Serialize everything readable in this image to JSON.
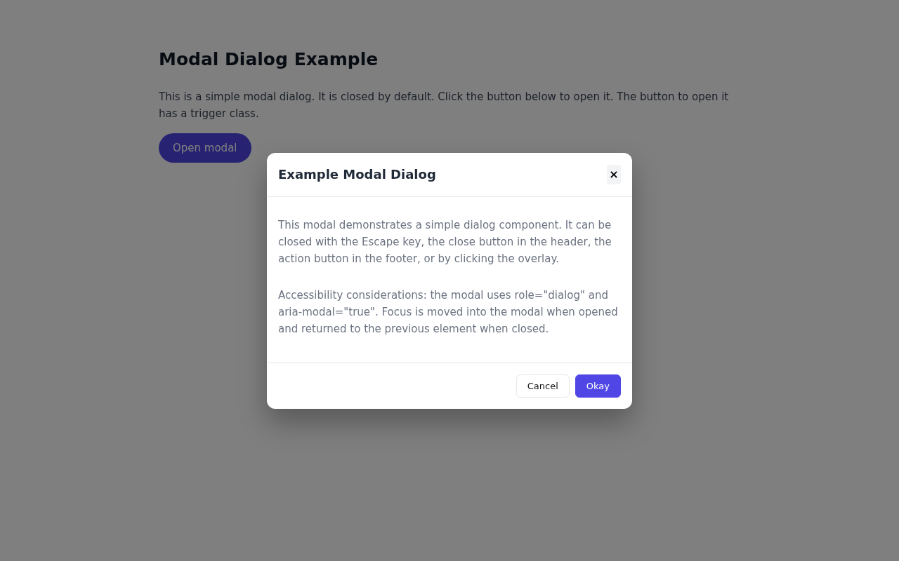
{
  "page": {
    "title": "Modal Dialog Example",
    "description": "This is a simple modal dialog. It is closed by default. Click the button below to open it. The button to open it has a trigger class.",
    "open_button": "Open modal"
  },
  "modal": {
    "title": "Example Modal Dialog",
    "close": "×",
    "paragraphs": [
      "This modal demonstrates a simple dialog component. It can be closed with the Escape key, the close button in the header, the action button in the footer, or by clicking the overlay.",
      "Accessibility considerations: the modal uses role=\"dialog\" and aria-modal=\"true\". Focus is moved into the modal when opened and returned to the previous element when closed."
    ],
    "buttons": [
      {
        "label": "Cancel",
        "kind": "secondary"
      },
      {
        "label": "Okay",
        "kind": "primary"
      }
    ]
  }
}
